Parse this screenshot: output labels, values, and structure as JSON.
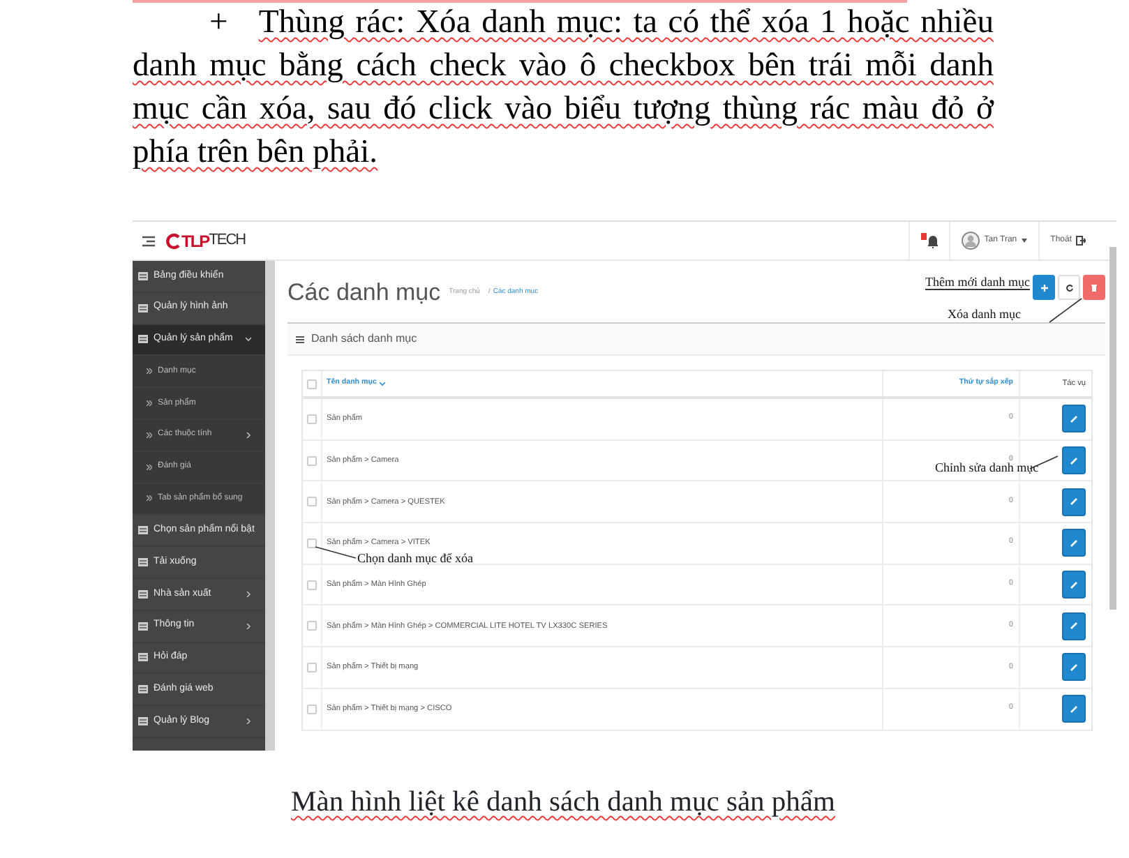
{
  "document": {
    "paragraph": {
      "bullet": "+",
      "text": "Thùng rác: Xóa danh mục: ta có thể xóa 1 hoặc nhiều danh mục bằng cách check vào ô checkbox bên trái mỗi danh mục cần xóa, sau đó click vào biểu tượng thùng rác màu đỏ ở phía trên bên phải."
    },
    "screenshot": {
      "topbar": {
        "logo": [
          "TLP",
          "TECH"
        ],
        "user": "Tan Tran",
        "logout": "Thoát"
      },
      "sidebar": [
        {
          "label": "Bảng điều khiển",
          "kind": "main",
          "children": false,
          "expanded": false
        },
        {
          "label": "Quản lý hình ảnh",
          "kind": "main",
          "children": false,
          "expanded": false
        },
        {
          "label": "Quản lý sản phẩm",
          "kind": "main",
          "children": true,
          "expanded": true
        },
        {
          "label": "Danh mục",
          "kind": "sub",
          "children": false,
          "expanded": false
        },
        {
          "label": "Sản phẩm",
          "kind": "sub",
          "children": false,
          "expanded": false
        },
        {
          "label": "Các thuộc tính",
          "kind": "sub",
          "children": true,
          "expanded": false
        },
        {
          "label": "Đánh giá",
          "kind": "sub",
          "children": false,
          "expanded": false
        },
        {
          "label": "Tab sản phẩm bổ sung",
          "kind": "sub",
          "children": false,
          "expanded": false
        },
        {
          "label": "Chọn sản phẩm nổi bật",
          "kind": "main",
          "children": false,
          "expanded": false
        },
        {
          "label": "Tải xuống",
          "kind": "main",
          "children": false,
          "expanded": false
        },
        {
          "label": "Nhà sản xuất",
          "kind": "main",
          "children": true,
          "expanded": false
        },
        {
          "label": "Thông tin",
          "kind": "main",
          "children": true,
          "expanded": false
        },
        {
          "label": "Hỏi đáp",
          "kind": "main",
          "children": false,
          "expanded": false
        },
        {
          "label": "Đánh giá web",
          "kind": "main",
          "children": false,
          "expanded": false
        },
        {
          "label": "Quản lý Blog",
          "kind": "main",
          "children": true,
          "expanded": false
        }
      ],
      "page_title": "Các danh mục",
      "breadcrumb": [
        {
          "label": "Trang chủ",
          "selected": false
        },
        {
          "label": "Các danh mục",
          "selected": true
        }
      ],
      "breadcrumb_separator": "/",
      "panel_title": "Danh sách danh mục",
      "table": {
        "all_checked": false,
        "columns": [
          "Tên danh mục",
          "Thứ tự sắp xếp",
          "Tác vụ"
        ],
        "rows": [
          {
            "name": "Sản phẩm",
            "order": "0",
            "checked": false
          },
          {
            "name": "Sản phẩm > Camera",
            "order": "0",
            "checked": false
          },
          {
            "name": "Sản phẩm > Camera > QUESTEK",
            "order": "0",
            "checked": false
          },
          {
            "name": "Sản phẩm > Camera > VITEK",
            "order": "0",
            "checked": false
          },
          {
            "name": "Sản phẩm > Màn Hình Ghép",
            "order": "0",
            "checked": false
          },
          {
            "name": "Sản phẩm > Màn Hình Ghép > COMMERCIAL LITE HOTEL TV LX330C SERIES",
            "order": "0",
            "checked": false
          },
          {
            "name": "Sản phẩm > Thiết bị mạng",
            "order": "0",
            "checked": false
          },
          {
            "name": "Sản phẩm > Thiết bị mạng > CISCO",
            "order": "0",
            "checked": false
          }
        ]
      },
      "annotations": [
        {
          "text": "Thêm mới danh mục"
        },
        {
          "text": "Xóa danh mục"
        },
        {
          "text": "Chỉnh sửa danh mục"
        },
        {
          "text": "Chọn danh mục để xóa"
        }
      ]
    },
    "caption": "Màn hình liệt kê danh sách danh mục sản phẩm"
  }
}
